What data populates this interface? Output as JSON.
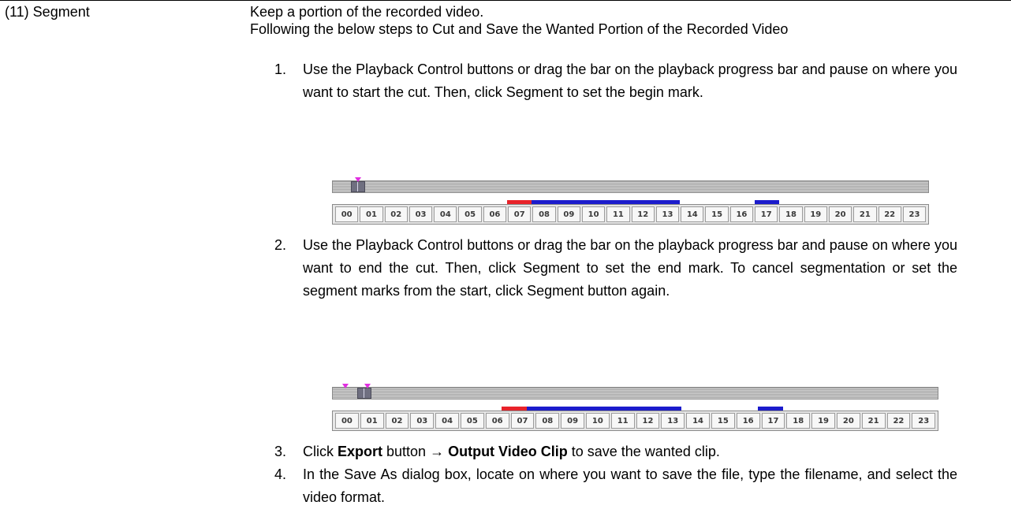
{
  "label": "(11) Segment",
  "intro": [
    "Keep a portion of the recorded video.",
    "Following the below steps to Cut and Save the Wanted Portion of the Recorded Video"
  ],
  "steps": [
    {
      "num": "1.",
      "text": "Use the Playback Control buttons or drag the bar on the playback progress bar and pause on where you want to start the cut. Then, click Segment to set the begin mark."
    },
    {
      "num": "2.",
      "text": "Use the Playback Control buttons or drag the bar on the playback progress bar and pause on where you want to end the cut. Then, click Segment to set the end mark. To cancel segmentation or set the segment marks from the start, click Segment button again."
    },
    {
      "num": "3.",
      "pre": "Click ",
      "b1": "Export",
      "mid": " button → ",
      "b2": "Output Video Clip",
      "post": " to save the wanted clip."
    },
    {
      "num": "4.",
      "text": "In the Save As dialog box, locate on where you want to save the file, type the filename, and select the video format."
    }
  ],
  "timeline": {
    "hours": [
      "00",
      "01",
      "02",
      "03",
      "04",
      "05",
      "06",
      "07",
      "08",
      "09",
      "10",
      "11",
      "12",
      "13",
      "14",
      "15",
      "16",
      "17",
      "18",
      "19",
      "20",
      "21",
      "22",
      "23"
    ],
    "segment_colors": {
      "red": "#e8232a",
      "blue": "#1c1ccc",
      "pink": "#e02ee0"
    }
  }
}
